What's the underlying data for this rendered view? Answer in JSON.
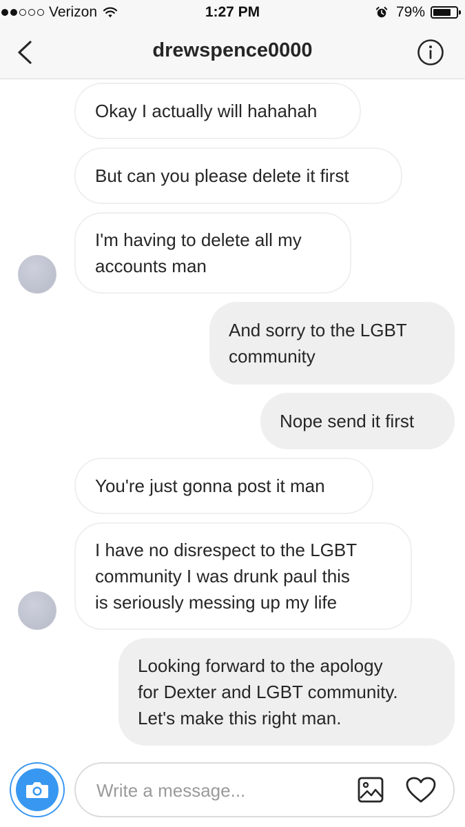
{
  "status_bar": {
    "carrier": "Verizon",
    "time": "1:27 PM",
    "battery_percent": "79%",
    "battery_level": 0.79,
    "signal_bars_filled": 2,
    "signal_bars_total": 5,
    "icons": [
      "signal-dots",
      "wifi-icon",
      "alarm-icon",
      "battery-icon"
    ]
  },
  "header": {
    "title": "drewspence0000",
    "back_icon": "chevron-left-icon",
    "info_icon": "info-icon"
  },
  "messages": [
    {
      "direction": "incoming",
      "lines": [
        "Okay I actually will hahahah"
      ]
    },
    {
      "direction": "incoming",
      "lines": [
        "But can you please delete it first"
      ]
    },
    {
      "direction": "incoming",
      "lines": [
        "I'm having to delete all my",
        "accounts man"
      ],
      "avatar": true
    },
    {
      "direction": "outgoing",
      "lines": [
        "And sorry to the LGBT",
        "community"
      ]
    },
    {
      "direction": "outgoing",
      "lines": [
        "Nope send it first"
      ]
    },
    {
      "direction": "incoming",
      "lines": [
        "You're just gonna post it man"
      ]
    },
    {
      "direction": "incoming",
      "lines": [
        "I have no disrespect to the LGBT",
        "community I was drunk paul this",
        "is seriously messing up my life"
      ],
      "avatar": true
    },
    {
      "direction": "outgoing",
      "lines": [
        "Looking forward to the apology",
        "for Dexter and LGBT community.",
        "Let's make this right man."
      ]
    }
  ],
  "composer": {
    "placeholder": "Write a message...",
    "value": "",
    "camera_icon": "camera-icon",
    "gallery_icon": "image-icon",
    "like_icon": "heart-icon"
  },
  "colors": {
    "accent": "#3897f0",
    "outgoing_bubble": "#efefef",
    "incoming_border": "#efefef",
    "text": "#262626",
    "header_bg": "#f7f7f7"
  }
}
